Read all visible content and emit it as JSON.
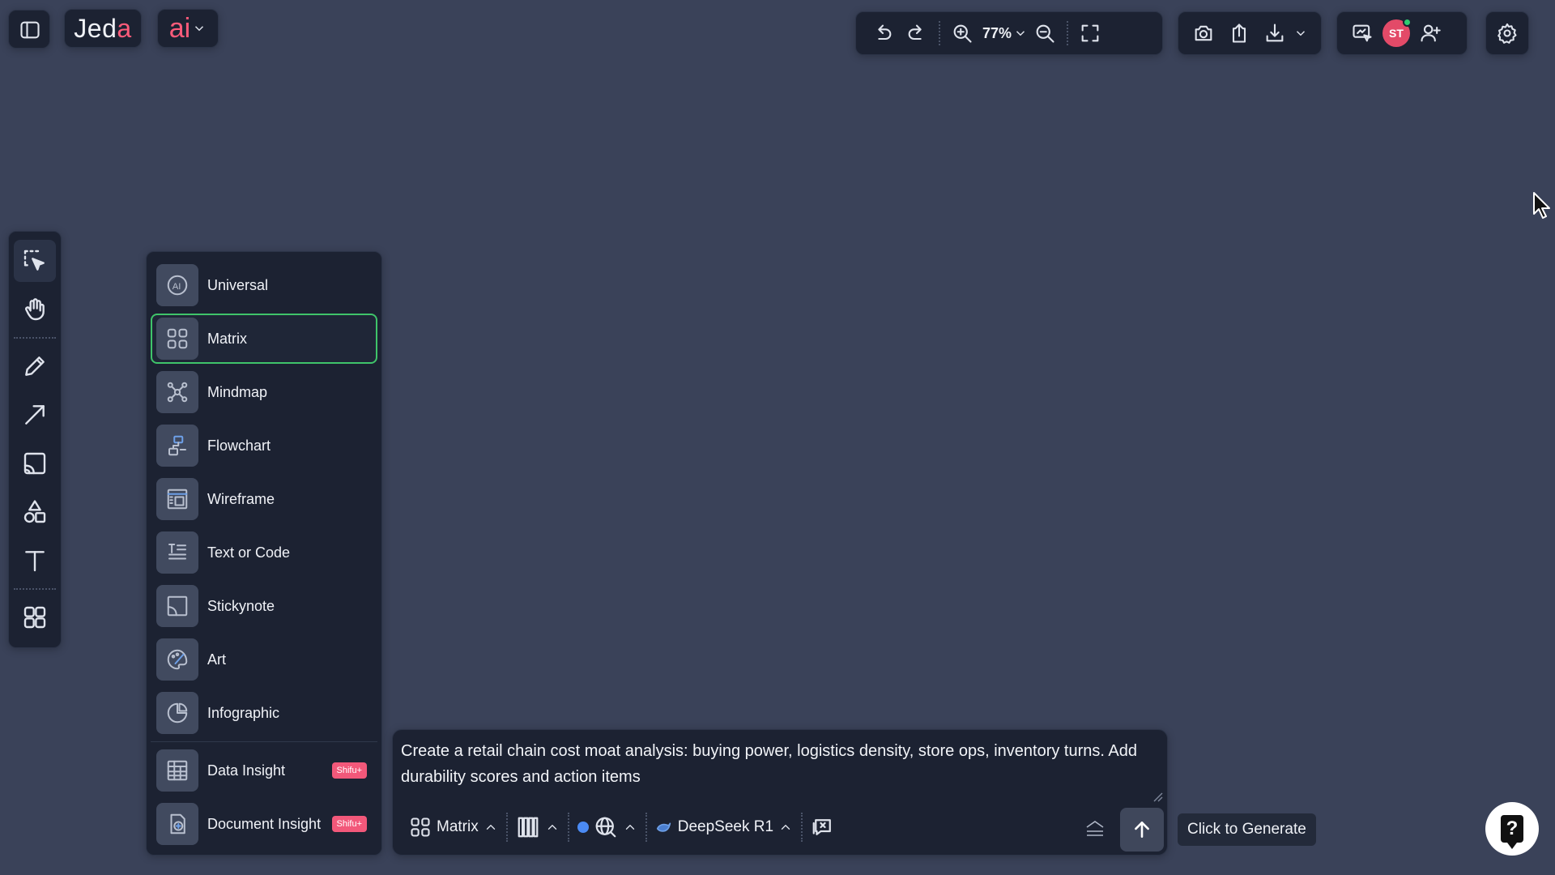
{
  "app": {
    "logo_text_main": "Jed",
    "logo_text_accent": "a",
    "ai_label": "ai"
  },
  "toolbar": {
    "zoom_value": "77%"
  },
  "user": {
    "avatar_initials": "ST"
  },
  "tools": [
    {
      "name": "select-tool",
      "icon": "select-icon",
      "active": true
    },
    {
      "name": "hand-tool",
      "icon": "hand-icon",
      "active": false
    },
    {
      "name": "pen-tool",
      "icon": "pencil-icon",
      "active": false
    },
    {
      "name": "arrow-tool",
      "icon": "arrow-icon",
      "active": false
    },
    {
      "name": "image-tool",
      "icon": "image-icon",
      "active": false
    },
    {
      "name": "shapes-tool",
      "icon": "shapes-icon",
      "active": false
    },
    {
      "name": "text-tool",
      "icon": "text-icon",
      "active": false
    },
    {
      "name": "templates-tool",
      "icon": "grid-icon",
      "active": false
    }
  ],
  "type_menu": {
    "items": [
      {
        "label": "Universal",
        "icon": "ai-icon",
        "selected": false
      },
      {
        "label": "Matrix",
        "icon": "matrix-icon",
        "selected": true
      },
      {
        "label": "Mindmap",
        "icon": "mindmap-icon",
        "selected": false
      },
      {
        "label": "Flowchart",
        "icon": "flowchart-icon",
        "selected": false
      },
      {
        "label": "Wireframe",
        "icon": "wireframe-icon",
        "selected": false
      },
      {
        "label": "Text or Code",
        "icon": "text-code-icon",
        "selected": false
      },
      {
        "label": "Stickynote",
        "icon": "stickynote-icon",
        "selected": false
      },
      {
        "label": "Art",
        "icon": "art-icon",
        "selected": false
      },
      {
        "label": "Infographic",
        "icon": "infographic-icon",
        "selected": false
      }
    ],
    "premium_items": [
      {
        "label": "Data Insight",
        "badge": "Shifu+",
        "icon": "data-insight-icon"
      },
      {
        "label": "Document Insight",
        "badge": "Shifu+",
        "icon": "document-insight-icon"
      }
    ]
  },
  "prompt": {
    "text": "Create a retail chain cost moat analysis: buying power, logistics density, store ops, inventory turns. Add durability scores and action items",
    "type_label": "Matrix",
    "model_label": "DeepSeek R1"
  },
  "tooltip": {
    "text": "Click to Generate"
  },
  "help": {
    "label": "?"
  },
  "colors": {
    "background": "#3a4259",
    "panel": "#1c2232",
    "accent_pink": "#ff5b7a",
    "selected_border": "#3fc46a",
    "badge": "#f2587a",
    "online_dot": "#2ecc71"
  }
}
